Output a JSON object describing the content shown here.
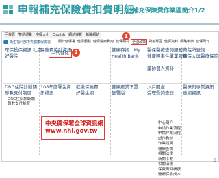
{
  "slide": {
    "title": "申報補充保險費扣費明細",
    "subtitle": "-補充保險費作業區簡介1/2",
    "page_number": "6"
  },
  "site": {
    "name": "衛生福利部中央健康保險署",
    "topnav": [
      "回首頁",
      "雙語詞彙",
      "字級大小",
      "English",
      "網站導覽",
      "新開網站"
    ],
    "menu": [
      "關於健保署",
      "健保服務",
      "健保醫療費用",
      "健保藥材",
      "全國政策",
      "對象專區",
      "健保資料",
      "網路申辦",
      "健保周刊"
    ]
  },
  "columns": {
    "c1": {
      "items": [
        "眾保投保資訊 社區",
        "好醫院",
        "DRG住院診斷關",
        "聯數支付制度",
        "DRG住院診斷關",
        "聯數支付制度"
      ]
    },
    "c2": {
      "items": [
        "保險費協助資訊",
        "二代健保",
        "108年度罪生資",
        "訊檔案"
      ]
    },
    "c3": {
      "items": [
        "欲繳保險費",
        "好醫生網"
      ]
    },
    "c4": {
      "items": [
        "健康存摺　My",
        "Health Bank",
        "健康產業下置",
        "告署版"
      ]
    },
    "c5": {
      "items": [
        "醫保醫療查詢服務",
        "健康照事件單業服務",
        "藥師個人資料",
        "入戶關處",
        "受理暨詢查登"
      ]
    },
    "c6": {
      "items": [
        "藥院所查詢",
        "健保大與醫療保詢",
        "醫療與專業資訊",
        "連網資訊"
      ]
    }
  },
  "right_list": [
    "中心簡介",
    "申請作業流程",
    "申請作業流程",
    "試作教材",
    "作業說明",
    "醫療查詢",
    "相關法律",
    "新聞下載",
    "相關法規",
    "保費寄回帳號",
    "醫療保險成本"
  ],
  "callout": {
    "line1": "中央健保署全球資訊網",
    "line2": "www.nhi.gov.tw"
  },
  "badges": {
    "one": "1",
    "two": "2"
  },
  "colors": {
    "title": "#2a9aa0",
    "highlight": "#e23a3a",
    "link": "#2a4b73"
  }
}
